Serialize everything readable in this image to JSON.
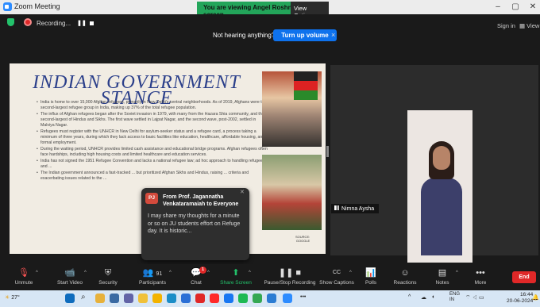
{
  "window": {
    "title": "Zoom Meeting"
  },
  "banner": {
    "text": "You are viewing Angel Roshni's screen",
    "view_options": "View Options ⌄"
  },
  "window_controls": {
    "minimize": "–",
    "maximize": "▢",
    "close": "✕"
  },
  "meeting_bar": {
    "recording": "Recording...",
    "pause": "❚❚",
    "sign_in": "Sign in",
    "view": "View"
  },
  "notice": {
    "message": "Not hearing anything?",
    "button": "Turn up volume",
    "close": "×"
  },
  "slide": {
    "title": "INDIAN GOVERNMENT STANCE",
    "bullets": [
      "India is home to over 15,000 Afghan refugees, primarily in New Delhi's central neighborhoods. As of 2019, Afghans were the second-largest refugee group in India, making up 37% of the total refugee population.",
      "The influx of Afghan refugees began after the Soviet invasion in 1979, with many from the Hazara Shia community, and the second-largest of Hindus and Sikhs. The first wave settled in Lajpat Nagar, and the second wave, post-2002, settled in Malviya Nagar.",
      "Refugees must register with the UNHCR in New Delhi for asylum-seeker status and a refugee card, a process taking a minimum of three years, during which they lack access to basic facilities like education, healthcare, affordable housing, and formal employment.",
      "During the waiting period, UNHCR provides limited cash assistance and educational bridge programs. Afghan refugees often face hardships, including high housing costs and limited healthcare and education services.",
      "India has not signed the 1951 Refugee Convention and lacks a national refugee law; ad hoc approach to handling refugees and ...",
      "The Indian government announced a fast-tracked ... but prioritized Afghan Sikhs and Hindus, raising ... criteria and exacerbating issues related to the ..."
    ],
    "source": "SOURCE:\nGOOGLE"
  },
  "participant": {
    "name": "Nimna Aysha"
  },
  "chat_popup": {
    "avatar": "PJ",
    "header": "From Prof. Jagannatha Venkataramaiah to Everyone",
    "message": "I may share my thoughts for a minute or so on JU students effort on Refuge day. It is historic...",
    "close": "✕"
  },
  "toolbar": {
    "unmute": "Unmute",
    "start_video": "Start Video",
    "security": "Security",
    "participants": "Participants",
    "participants_count": "91",
    "chat": "Chat",
    "chat_badge": "1",
    "share_screen": "Share Screen",
    "pause_recording": "Pause/Stop Recording",
    "show_captions": "Show Captions",
    "cc": "CC",
    "polls": "Polls",
    "reactions": "Reactions",
    "notes": "Notes",
    "more": "More",
    "more_icon": "•••",
    "end": "End"
  },
  "taskbar": {
    "weather": "27°",
    "lang": "ENG\nIN",
    "time": "16:44",
    "date": "20-06-2024",
    "overflow": "•••"
  },
  "colors": {
    "accent_blue": "#0e72ed",
    "banner_green": "#23a55a",
    "end_red": "#e02828",
    "slide_title": "#2b3f8a"
  }
}
